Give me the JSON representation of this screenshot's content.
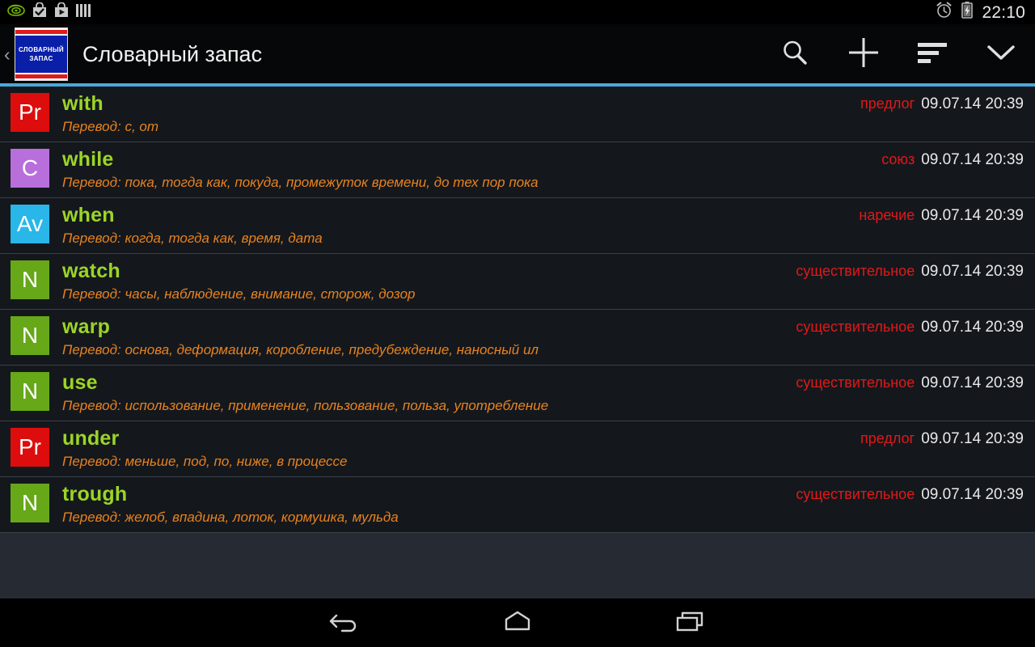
{
  "status_bar": {
    "left_icons": [
      "nvidia-logo-icon",
      "app-install-check-icon",
      "app-install-play-icon",
      "bars-icon"
    ],
    "right_icons": [
      "alarm-clock-icon",
      "battery-charging-icon"
    ],
    "time": "22:10"
  },
  "app_bar": {
    "up_chevron": "‹",
    "logo": {
      "line1": "СЛОВАРНЫЙ",
      "line2": "ЗАПАС"
    },
    "title": "Словарный запас",
    "actions": [
      {
        "name": "search-icon",
        "label": "Поиск"
      },
      {
        "name": "add-icon",
        "label": "Добавить"
      },
      {
        "name": "sort-icon",
        "label": "Сортировка"
      },
      {
        "name": "chevron-down-icon",
        "label": "Ещё"
      }
    ]
  },
  "colors": {
    "accent_line": "#4aa8d8",
    "word": "#9bd526",
    "translation": "#e8821e",
    "pos": "#e01919",
    "date": "#e9e9e9",
    "badge_preposition": "#dd0d0d",
    "badge_conjunction": "#b86fdb",
    "badge_adverb": "#29b6e8",
    "badge_noun": "#66a818",
    "row_bg": "#14181d",
    "list_bg": "#262b33"
  },
  "list": {
    "translation_prefix": "Перевод:",
    "rows": [
      {
        "badge": "Pr",
        "badge_color": "#dd0d0d",
        "word": "with",
        "translation": "Перевод: с, от",
        "pos": "предлог",
        "date": "09.07.14 20:39"
      },
      {
        "badge": "C",
        "badge_color": "#b86fdb",
        "word": "while",
        "translation": "Перевод: пока, тогда как, покуда, промежуток времени, до тех пор пока",
        "pos": "союз",
        "date": "09.07.14 20:39"
      },
      {
        "badge": "Av",
        "badge_color": "#29b6e8",
        "word": "when",
        "translation": "Перевод: когда, тогда как, время, дата",
        "pos": "наречие",
        "date": "09.07.14 20:39"
      },
      {
        "badge": "N",
        "badge_color": "#66a818",
        "word": "watch",
        "translation": "Перевод: часы, наблюдение, внимание, сторож, дозор",
        "pos": "существительное",
        "date": "09.07.14 20:39"
      },
      {
        "badge": "N",
        "badge_color": "#66a818",
        "word": "warp",
        "translation": "Перевод: основа, деформация, коробление, предубеждение, наносный ил",
        "pos": "существительное",
        "date": "09.07.14 20:39"
      },
      {
        "badge": "N",
        "badge_color": "#66a818",
        "word": "use",
        "translation": "Перевод: использование, применение, пользование, польза, употребление",
        "pos": "существительное",
        "date": "09.07.14 20:39"
      },
      {
        "badge": "Pr",
        "badge_color": "#dd0d0d",
        "word": "under",
        "translation": "Перевод: меньше, под, по, ниже, в процессе",
        "pos": "предлог",
        "date": "09.07.14 20:39"
      },
      {
        "badge": "N",
        "badge_color": "#66a818",
        "word": "trough",
        "translation": "Перевод: желоб, впадина, лоток, кормушка, мульда",
        "pos": "существительное",
        "date": "09.07.14 20:39"
      }
    ]
  },
  "nav_bar": {
    "buttons": [
      {
        "name": "back-icon",
        "label": "Назад"
      },
      {
        "name": "home-icon",
        "label": "Домой"
      },
      {
        "name": "recents-icon",
        "label": "Недавние"
      }
    ]
  }
}
